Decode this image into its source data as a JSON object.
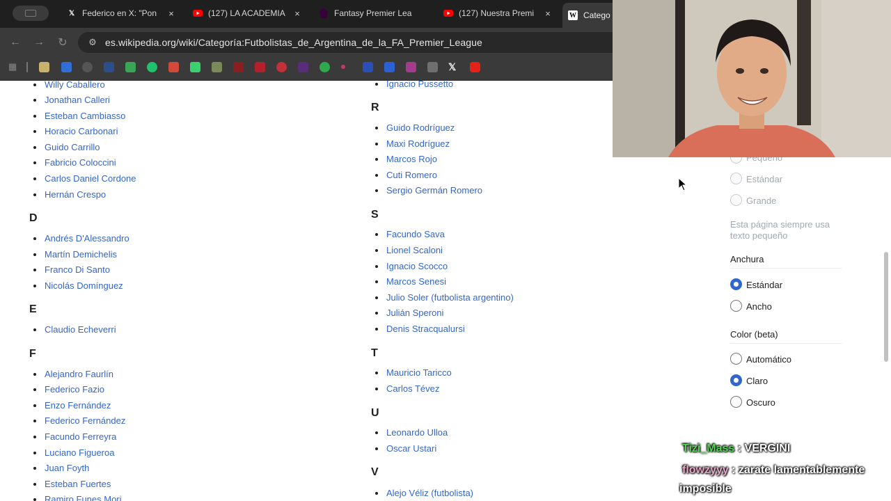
{
  "browser": {
    "tabs": [
      {
        "title": "Federico en X: \"Pon",
        "icon": "x-icon"
      },
      {
        "title": "(127) LA ACADEMIA",
        "icon": "youtube-icon"
      },
      {
        "title": "Fantasy Premier Lea",
        "icon": "fpl-icon"
      },
      {
        "title": "(127) Nuestra Premi",
        "icon": "youtube-icon"
      },
      {
        "title": "Catego",
        "icon": "wikipedia-icon"
      }
    ],
    "close_glyph": "×",
    "url": "es.wikipedia.org/wiki/Categoría:Futbolistas_de_Argentina_de_la_FA_Premier_League"
  },
  "left_column": {
    "items_top": [
      "Willy Caballero",
      "Jonathan Calleri",
      "Esteban Cambiasso",
      "Horacio Carbonari",
      "Guido Carrillo",
      "Fabricio Coloccini",
      "Carlos Daniel Cordone",
      "Hernán Crespo"
    ],
    "sections": [
      {
        "letter": "D",
        "items": [
          "Andrés D'Alessandro",
          "Martín Demichelis",
          "Franco Di Santo",
          "Nicolás Domínguez"
        ]
      },
      {
        "letter": "E",
        "items": [
          "Claudio Echeverri"
        ]
      },
      {
        "letter": "F",
        "items": [
          "Alejandro Faurlín",
          "Federico Fazio",
          "Enzo Fernández",
          "Federico Fernández",
          "Facundo Ferreyra",
          "Luciano Figueroa",
          "Juan Foyth",
          "Esteban Fuertes",
          "Ramiro Funes Mori"
        ]
      }
    ]
  },
  "right_column": {
    "items_top": [
      "Ignacio Pussetto"
    ],
    "sections": [
      {
        "letter": "R",
        "items": [
          "Guido Rodríguez",
          "Maxi Rodríguez",
          "Marcos Rojo",
          "Cuti Romero",
          "Sergio Germán Romero"
        ]
      },
      {
        "letter": "S",
        "items": [
          "Facundo Sava",
          "Lionel Scaloni",
          "Ignacio Scocco",
          "Marcos Senesi",
          "Julio Soler (futbolista argentino)",
          "Julián Speroni",
          "Denis Stracqualursi"
        ]
      },
      {
        "letter": "T",
        "items": [
          "Mauricio Taricco",
          "Carlos Tévez"
        ]
      },
      {
        "letter": "U",
        "items": [
          "Leonardo Ulloa",
          "Oscar Ustari"
        ]
      },
      {
        "letter": "V",
        "items": [
          "Alejo Véliz (futbolista)"
        ]
      }
    ]
  },
  "appearance_panel": {
    "text_sizes": [
      "Pequeño",
      "Estándar",
      "Grande"
    ],
    "text_note": "Esta página siempre usa texto pequeño",
    "width_heading": "Anchura",
    "width_options": [
      {
        "label": "Estándar",
        "selected": true
      },
      {
        "label": "Ancho",
        "selected": false
      }
    ],
    "color_heading": "Color (beta)",
    "color_options": [
      {
        "label": "Automático",
        "selected": false
      },
      {
        "label": "Claro",
        "selected": true
      },
      {
        "label": "Oscuro",
        "selected": false
      }
    ]
  },
  "chat": [
    {
      "user": "Tizi_Mass",
      "message": "VERGINI"
    },
    {
      "user": "flowzyyy",
      "message": "zarate lamentablemente",
      "message_cont": "imposible"
    }
  ],
  "colors": {
    "link": "#3366cc",
    "accent": "#3366cc",
    "text": "#202122"
  }
}
